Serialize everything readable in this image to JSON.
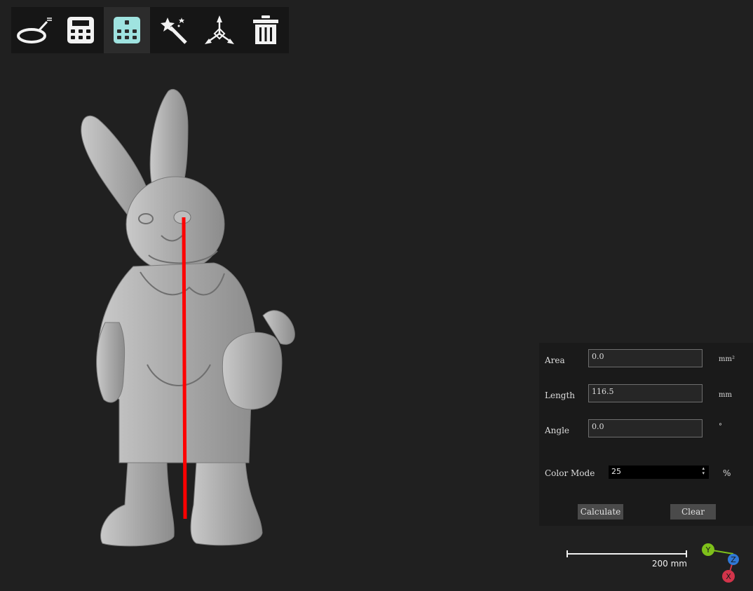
{
  "toolbar": {
    "tools": [
      {
        "icon": "ring-measure-icon",
        "active": false
      },
      {
        "icon": "calculator-icon",
        "active": false
      },
      {
        "icon": "calculator-active-icon",
        "active": true
      },
      {
        "icon": "magic-wand-icon",
        "active": false
      },
      {
        "icon": "axes-tripod-icon",
        "active": false
      },
      {
        "icon": "trash-icon",
        "active": false
      }
    ]
  },
  "measure_panel": {
    "area": {
      "label": "Area",
      "value": "0.0",
      "unit": "mm²"
    },
    "length": {
      "label": "Length",
      "value": "116.5",
      "unit": "mm"
    },
    "angle": {
      "label": "Angle",
      "value": "0.0",
      "unit": "°"
    },
    "color_mode": {
      "label": "Color Mode",
      "value": "25",
      "unit": "%"
    },
    "calculate_label": "Calculate",
    "clear_label": "Clear"
  },
  "scale_bar": {
    "label": "200 mm"
  },
  "axes": {
    "y": "Y",
    "z": "Z",
    "x": "X"
  },
  "colors": {
    "measure_line": "#ff0000",
    "active_icon": "#9fe3e0",
    "axis_y": "#7ec01a",
    "axis_z": "#2f78d6",
    "axis_x": "#d2344a"
  }
}
